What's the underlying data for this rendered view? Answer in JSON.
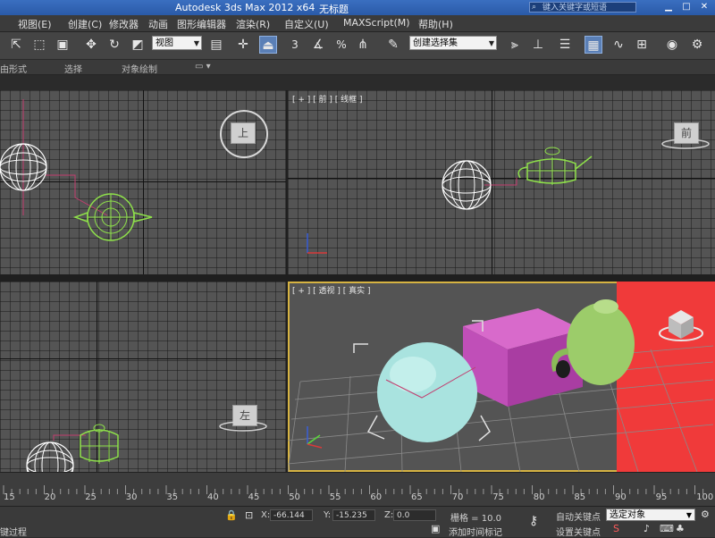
{
  "titlebar": {
    "app_title": "Autodesk 3ds Max  2012 x64",
    "document": "无标题",
    "search_placeholder": "键入关键字或短语",
    "window_buttons": [
      "minimize-icon",
      "maximize-icon",
      "close-icon"
    ]
  },
  "menubar": {
    "items": [
      "视图(E)",
      "创建(C)",
      "修改器",
      "动画",
      "图形编辑器",
      "渲染(R)",
      "自定义(U)",
      "MAXScript(M)",
      "帮助(H)"
    ]
  },
  "toolbar": {
    "ref_coord": "视图",
    "angle_snap_label": "3",
    "percent_snap_label": "%",
    "named_selection": "创建选择集"
  },
  "ribbon": {
    "items": [
      "由形式",
      "选择",
      "对象绘制"
    ]
  },
  "viewports": {
    "top": {
      "label": "",
      "cube": "上"
    },
    "front": {
      "label": "[ + ] [ 前 ] [ 线框 ]",
      "cube": "前"
    },
    "left": {
      "label": "",
      "cube": "左"
    },
    "perspective": {
      "label": "[ + ] [ 透视 ] [ 真实 ]",
      "cube": ""
    }
  },
  "timeline": {
    "ticks": [
      "15",
      "20",
      "25",
      "30",
      "35",
      "40",
      "45",
      "50",
      "55",
      "60",
      "65",
      "70",
      "75",
      "80",
      "85",
      "90",
      "95",
      "100"
    ]
  },
  "status": {
    "x_label": "X:",
    "x_value": "-66.144",
    "y_label": "Y:",
    "y_value": "-15.235",
    "z_label": "Z:",
    "z_value": "0.0",
    "grid_label": "栅格 = 10.0",
    "autokey_label": "自动关键点",
    "selection_set": "选定对象",
    "setkey_label": "设置关键点",
    "add_time_tag": "添加时间标记",
    "prompt_left": "键过程"
  },
  "colors": {
    "titlebar": "#2f62b2",
    "viewport_grid": "#545454",
    "active_border": "#d6b342",
    "teapot_wire": "#8ee04a",
    "sphere_wire": "#ffffff",
    "box": "#c04fb8",
    "background_red": "#f03a3a"
  }
}
